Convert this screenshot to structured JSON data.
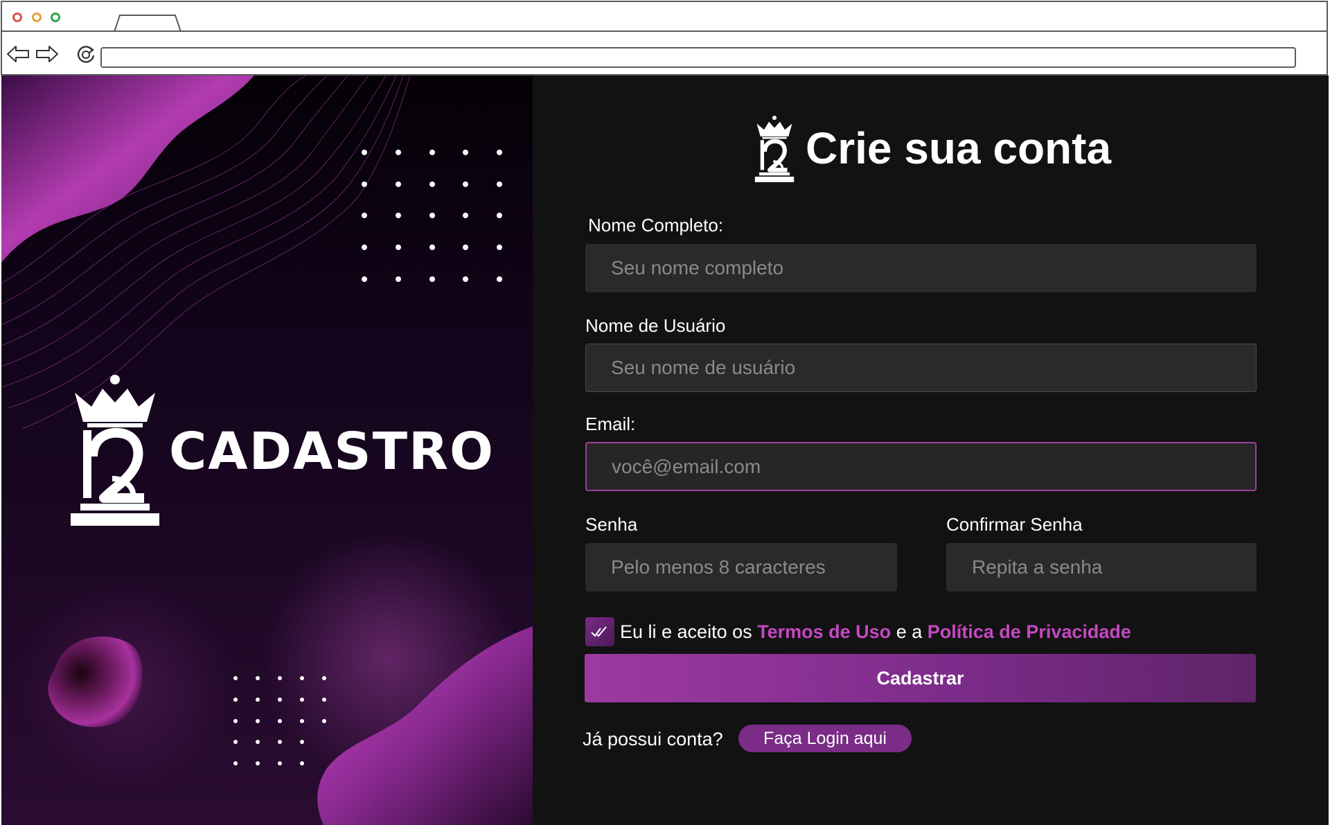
{
  "browser": {
    "url": ""
  },
  "hero": {
    "title": "CADASTRO"
  },
  "form": {
    "title": "Crie sua conta",
    "full_name": {
      "label": "Nome Completo:",
      "placeholder": "Seu nome completo"
    },
    "username": {
      "label": "Nome de Usuário",
      "placeholder": "Seu nome de usuário"
    },
    "email": {
      "label": "Email:",
      "placeholder": "você@email.com"
    },
    "password": {
      "label": "Senha",
      "placeholder": "Pelo menos 8 caracteres"
    },
    "confirm_password": {
      "label": "Confirmar Senha",
      "placeholder": "Repita a senha"
    },
    "terms": {
      "checked": true,
      "prefix": "Eu li e aceito os",
      "terms_link": "Termos de Uso",
      "middle": "e a",
      "privacy_link": "Política de Privacidade"
    },
    "submit_label": "Cadastrar",
    "login_prompt": "Já possui conta?",
    "login_button": "Faça Login aqui"
  },
  "colors": {
    "accent": "#9d3aa0",
    "link": "#c548c4",
    "panel_bg": "#121212",
    "input_bg": "#2a2a2a"
  },
  "icons": {
    "logo": "crown-2-logo-icon",
    "checkbox": "double-check-icon"
  }
}
